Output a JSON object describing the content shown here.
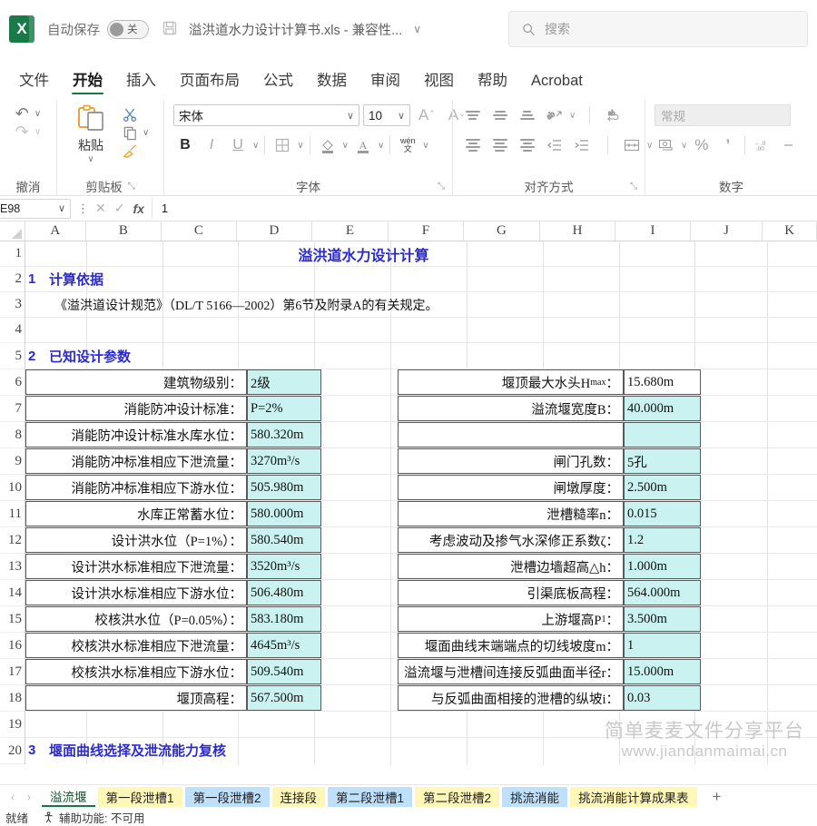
{
  "titlebar": {
    "logo_text": "X",
    "autosave_label": "自动保存",
    "autosave_state": "关",
    "document_title": "溢洪道水力设计计算书.xls  -  兼容性...",
    "search_placeholder": "搜索"
  },
  "ribbon_tabs": [
    {
      "label": "文件",
      "active": false
    },
    {
      "label": "开始",
      "active": true
    },
    {
      "label": "插入",
      "active": false
    },
    {
      "label": "页面布局",
      "active": false
    },
    {
      "label": "公式",
      "active": false
    },
    {
      "label": "数据",
      "active": false
    },
    {
      "label": "审阅",
      "active": false
    },
    {
      "label": "视图",
      "active": false
    },
    {
      "label": "帮助",
      "active": false
    },
    {
      "label": "Acrobat",
      "active": false
    }
  ],
  "ribbon": {
    "groups": [
      {
        "label": "撤消"
      },
      {
        "label": "剪贴板",
        "paste_label": "粘贴"
      },
      {
        "label": "字体",
        "font_name": "宋体",
        "font_size": "10"
      },
      {
        "label": "对齐方式"
      },
      {
        "label": "数字",
        "number_format": "常规"
      }
    ]
  },
  "formula_bar": {
    "name_box": "E98",
    "fx_label": "fx",
    "formula_value": "1"
  },
  "grid": {
    "columns": [
      "A",
      "B",
      "C",
      "D",
      "E",
      "F",
      "G",
      "H",
      "I",
      "J",
      "K"
    ],
    "row_numbers": [
      "1",
      "2",
      "3",
      "4",
      "5",
      "6",
      "7",
      "8",
      "9",
      "10",
      "11",
      "12",
      "13",
      "14",
      "15",
      "16",
      "17",
      "18",
      "19",
      "20"
    ],
    "title": "溢洪道水力设计计算",
    "section1_num": "1",
    "section1_label": "计算依据",
    "basis_text": "《溢洪道设计规范》（DL/T 5166—2002）第6节及附录A的有关规定。",
    "section2_num": "2",
    "section2_label": "已知设计参数",
    "section3_num": "3",
    "section3_label": "堰面曲线选择及泄流能力复核",
    "left_params": [
      {
        "label": "建筑物级别：",
        "value": "2级",
        "fill": "cyan"
      },
      {
        "label": "消能防冲设计标准：",
        "value": "P=2%",
        "fill": "cyan"
      },
      {
        "label": "消能防冲设计标准水库水位：",
        "value": "580.320m",
        "fill": "cyan"
      },
      {
        "label": "消能防冲标准相应下泄流量：",
        "value": "3270m³/s",
        "fill": "cyan"
      },
      {
        "label": "消能防冲标准相应下游水位：",
        "value": "505.980m",
        "fill": "cyan"
      },
      {
        "label": "水库正常蓄水位：",
        "value": "580.000m",
        "fill": "cyan"
      },
      {
        "label": "设计洪水位（P=1%）：",
        "value": "580.540m",
        "fill": "cyan"
      },
      {
        "label": "设计洪水标准相应下泄流量：",
        "value": "3520m³/s",
        "fill": "cyan"
      },
      {
        "label": "设计洪水标准相应下游水位：",
        "value": "506.480m",
        "fill": "cyan"
      },
      {
        "label": "校核洪水位（P=0.05%）：",
        "value": "583.180m",
        "fill": "cyan"
      },
      {
        "label": "校核洪水标准相应下泄流量：",
        "value": "4645m³/s",
        "fill": "cyan"
      },
      {
        "label": "校核洪水标准相应下游水位：",
        "value": "509.540m",
        "fill": "cyan"
      },
      {
        "label": "堰顶高程：",
        "value": "567.500m",
        "fill": "cyan"
      }
    ],
    "right_params": [
      {
        "label": "堰顶最大水头H<sub>max</sub>：",
        "value": "15.680m",
        "fill": "white"
      },
      {
        "label": "溢流堰宽度B：",
        "value": "40.000m",
        "fill": "cyan"
      },
      {
        "label": "",
        "value": "",
        "fill": "cyan"
      },
      {
        "label": "闸门孔数：",
        "value": "5孔",
        "fill": "cyan"
      },
      {
        "label": "闸墩厚度：",
        "value": "2.500m",
        "fill": "cyan"
      },
      {
        "label": "泄槽糙率n：",
        "value": "0.015",
        "fill": "cyan"
      },
      {
        "label": "考虑波动及掺气水深修正系数ζ：",
        "value": "1.2",
        "fill": "cyan"
      },
      {
        "label": "泄槽边墙超高△h：",
        "value": "1.000m",
        "fill": "cyan"
      },
      {
        "label": "引渠底板高程：",
        "value": "564.000m",
        "fill": "cyan"
      },
      {
        "label": "上游堰高P<sub>1</sub>：",
        "value": "3.500m",
        "fill": "cyan"
      },
      {
        "label": "堰面曲线末端端点的切线坡度m：",
        "value": "1",
        "fill": "cyan"
      },
      {
        "label": "溢流堰与泄槽间连接反弧曲面半径r：",
        "value": "15.000m",
        "fill": "cyan"
      },
      {
        "label": "与反弧曲面相接的泄槽的纵坡i：",
        "value": "0.03",
        "fill": "cyan"
      }
    ],
    "watermark_line1": "简单麦麦文件分享平台",
    "watermark_line2": "www.jiandanmaimai.cn"
  },
  "sheet_tabs": [
    {
      "label": "溢流堰",
      "style": "active"
    },
    {
      "label": "第一段泄槽1",
      "style": "yellow"
    },
    {
      "label": "第一段泄槽2",
      "style": "blue"
    },
    {
      "label": "连接段",
      "style": "yellow"
    },
    {
      "label": "第二段泄槽1",
      "style": "blue"
    },
    {
      "label": "第二段泄槽2",
      "style": "yellow"
    },
    {
      "label": "挑流消能",
      "style": "blue"
    },
    {
      "label": "挑流消能计算成果表",
      "style": "yellow"
    }
  ],
  "add_sheet_label": "+",
  "status_bar": {
    "ready": "就绪",
    "accessibility": "辅助功能: 不可用"
  },
  "colors": {
    "accent": "#107c41",
    "cell_fill": "#c9f2f0",
    "title_text": "#2a2ad0",
    "tab_yellow": "#fff7b8",
    "tab_blue": "#bfe0fb"
  }
}
